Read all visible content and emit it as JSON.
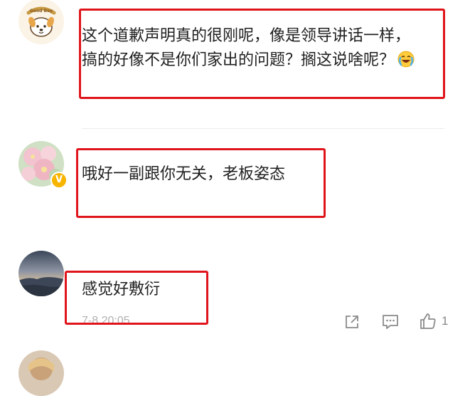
{
  "comments": [
    {
      "lines": [
        "这个道歉声明真的很刚呢，像是领导讲话一样，",
        "搞的好像不是你们家出的问题？搁这说啥呢？"
      ],
      "trailing_emoji": "crying-laughing-emoji",
      "avatar_icon": "good-boy-dog-avatar-icon",
      "avatar_logo_text": "Good Boy"
    },
    {
      "lines": [
        "哦好一副跟你无关，老板姿态"
      ],
      "avatar_icon": "pink-flower-avatar-icon",
      "verified_badge": "V"
    },
    {
      "lines": [
        "感觉好敷衍"
      ],
      "avatar_icon": "misty-landscape-avatar-icon",
      "timestamp": "7-8 20:05",
      "like_count": "1"
    }
  ],
  "colors": {
    "highlight_box": "#e0141b",
    "text": "#1f1f1f",
    "muted": "#b0b0b0",
    "badge": "#f7b500"
  }
}
